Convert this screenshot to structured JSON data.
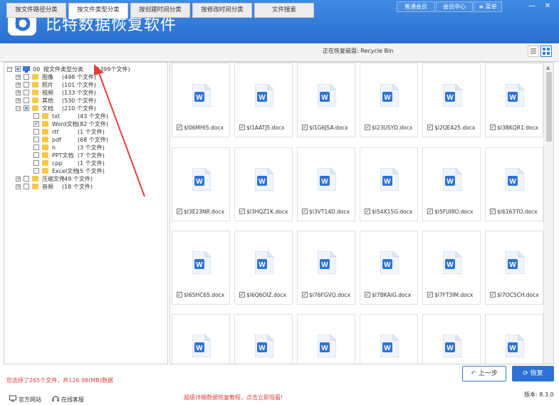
{
  "app": {
    "title": "比特数据恢复软件"
  },
  "topbar": {
    "member_label": "普通会员",
    "center_label": "会员中心",
    "menu_label": "菜单",
    "minimize": "—",
    "close": "✕"
  },
  "tabs": [
    {
      "label": "按文件路径分类",
      "active": false
    },
    {
      "label": "按文件类型分类",
      "active": true
    },
    {
      "label": "按创建时间分类",
      "active": false
    },
    {
      "label": "按修改时间分类",
      "active": false
    },
    {
      "label": "文件搜索",
      "active": false
    }
  ],
  "scan_label": "正在恢复磁盘: Recycle Bin",
  "tree": {
    "root": {
      "num": "00",
      "label": "按文件类型分类",
      "count": "(1399个文件)"
    },
    "items": [
      {
        "label": "图像",
        "count": "(498 个文件)"
      },
      {
        "label": "照片",
        "count": "(101 个文件)"
      },
      {
        "label": "视频",
        "count": "(133 个文件)"
      },
      {
        "label": "其他",
        "count": "(530 个文件)"
      },
      {
        "label": "文档",
        "count": "(210 个文件)"
      },
      {
        "label": "txt",
        "count": "(43 个文件)"
      },
      {
        "label": "Word文档",
        "count": "(82 个文件)"
      },
      {
        "label": "rtf",
        "count": "(1 个文件)"
      },
      {
        "label": "pdf",
        "count": "(68 个文件)"
      },
      {
        "label": "h",
        "count": "(3 个文件)"
      },
      {
        "label": "PPT文档",
        "count": "(7 个文件)"
      },
      {
        "label": "cpp",
        "count": "(1 个文件)"
      },
      {
        "label": "Excel文档",
        "count": "(5 个文件)"
      },
      {
        "label": "压缩文件",
        "count": "(49 个文件)"
      },
      {
        "label": "音频",
        "count": "(18 个文件)"
      }
    ]
  },
  "files": [
    "$I06MHI5.docx",
    "$I1AATJ5.docx",
    "$I1G6JSA.docx",
    "$I23USYD.docx",
    "$I2QEA25.docx",
    "$I3BKQR1.docx",
    "$I3E23NR.docx",
    "$I3HQZ1K.docx",
    "$I3VT14D.docx",
    "$I54X15G.docx",
    "$I5FUI8O.docx",
    "$I6163TO.docx",
    "$I65HC65.docx",
    "$I6Q6OIZ.docx",
    "$I76FGVQ.docx",
    "$I7BKAIG.docx",
    "$I7FT3IM.docx",
    "$I7OC5CH.docx",
    "",
    "",
    "",
    "",
    "",
    ""
  ],
  "footer": {
    "status": "您选择了265个文件，共126.98(MB)数据",
    "site_label": "官方网站",
    "service_label": "在线客服",
    "promo": "超级详细数据恢复教程，点击立即观看!",
    "prev_label": "上一步",
    "recover_label": "恢复",
    "version": "版本: 8.3.0"
  },
  "colors": {
    "header": "#2a6fd0",
    "accent": "#2f72d6",
    "warning": "#e03c3c",
    "arrow": "#e04040",
    "folder": "#f4c84c"
  }
}
